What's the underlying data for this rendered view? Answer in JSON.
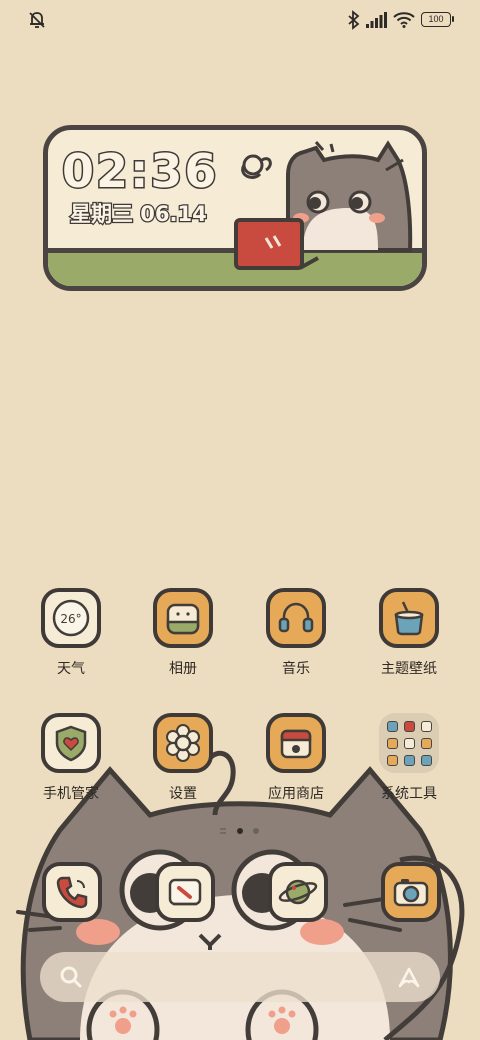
{
  "status_bar": {
    "battery": "100",
    "icons": [
      "mute-bell-icon",
      "bluetooth-icon",
      "signal-icon",
      "wifi-icon",
      "battery-icon"
    ]
  },
  "clock_widget": {
    "time": "02:36",
    "date": "星期三 06.14"
  },
  "apps": [
    {
      "label": "天气",
      "icon": "weather-icon",
      "value": "26°",
      "bg": "#f6ebd4"
    },
    {
      "label": "相册",
      "icon": "gallery-icon",
      "bg": "#e6a957"
    },
    {
      "label": "音乐",
      "icon": "headphones-icon",
      "bg": "#e6a957"
    },
    {
      "label": "主题壁纸",
      "icon": "paint-bucket-icon",
      "bg": "#e6a957"
    },
    {
      "label": "手机管家",
      "icon": "shield-heart-icon",
      "bg": "#f6ebd4"
    },
    {
      "label": "设置",
      "icon": "gear-flower-icon",
      "bg": "#e6a957"
    },
    {
      "label": "应用商店",
      "icon": "store-icon",
      "bg": "#e6a957"
    },
    {
      "label": "系统工具",
      "icon": "folder-icon"
    }
  ],
  "dock": [
    {
      "name": "phone",
      "icon": "phone-icon"
    },
    {
      "name": "messages",
      "icon": "message-icon"
    },
    {
      "name": "browser",
      "icon": "planet-icon"
    },
    {
      "name": "camera",
      "icon": "camera-icon"
    }
  ],
  "pages": {
    "count": 3,
    "active": 1
  },
  "colors": {
    "background": "#ecdcc0",
    "outline": "#3f3a37",
    "accent_orange": "#e6a957",
    "accent_green": "#9aab69",
    "accent_red": "#c94a3f",
    "accent_blue": "#6ba3b8"
  }
}
